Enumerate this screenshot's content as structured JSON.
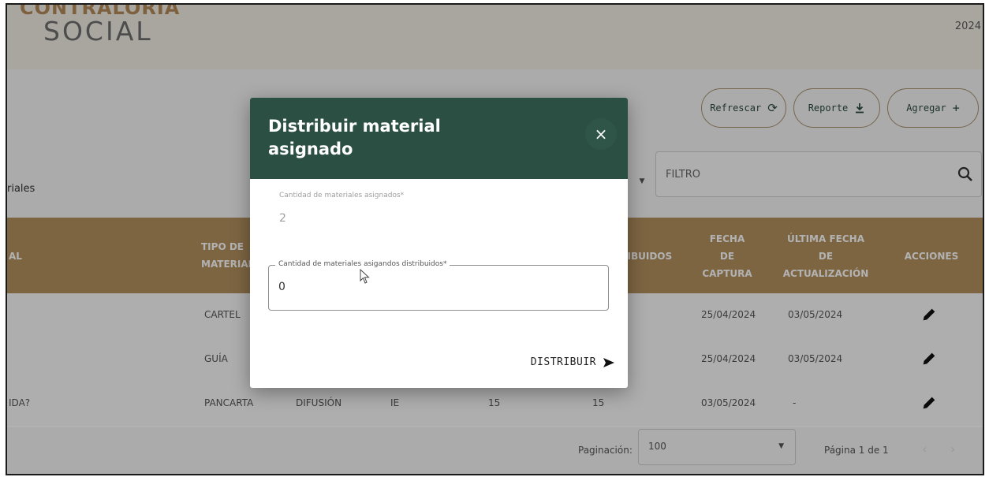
{
  "header": {
    "logo_line1": "CONTRALORIA",
    "logo_line2": "SOCIAL",
    "year": "2024"
  },
  "toolbar": {
    "refresh_label": "Refrescar",
    "report_label": "Reporte",
    "add_label": "Agregar"
  },
  "filter": {
    "left_text": "riales",
    "placeholder": "FILTRO"
  },
  "table": {
    "headers": {
      "col1": "AL",
      "tipo_line1": "TIPO DE",
      "tipo_line2": "MATERIAL",
      "distribuidos": "DISTRIBUIDOS",
      "fecha_line1": "FECHA",
      "fecha_line2": "DE",
      "fecha_line3": "CAPTURA",
      "ultima_line1": "ÚLTIMA FECHA",
      "ultima_line2": "DE",
      "ultima_line3": "ACTUALIZACIÓN",
      "acciones": "ACCIONES"
    },
    "rows": [
      {
        "col1": "",
        "tipo": "CARTEL",
        "col3": "",
        "col4": "",
        "col5": "",
        "col6": "",
        "fecha_captura": "25/04/2024",
        "ultima": "03/05/2024"
      },
      {
        "col1": "",
        "tipo": "GUÍA",
        "col3": "",
        "col4": "",
        "col5": "",
        "col6": "",
        "fecha_captura": "25/04/2024",
        "ultima": "03/05/2024"
      },
      {
        "col1": "IDA?",
        "tipo": "PANCARTA",
        "col3": "DIFUSIÓN",
        "col4": "IE",
        "col5": "15",
        "col6": "15",
        "fecha_captura": "03/05/2024",
        "ultima": "-"
      }
    ]
  },
  "pagination": {
    "label": "Paginación:",
    "value": "100",
    "page_info": "Página 1 de 1",
    "prev": "‹",
    "next": "›"
  },
  "modal": {
    "title": "Distribuir material asignado",
    "close": "×",
    "assigned_label": "Cantidad de materiales asignados*",
    "assigned_value": "2",
    "distributed_label": "Cantidad de materiales asigandos distribuidos*",
    "distributed_value": "0",
    "submit_label": "DISTRIBUIR"
  },
  "colors": {
    "header_green": "#2c4f44",
    "table_header_gold": "#b4915f",
    "button_border": "#a89270"
  },
  "icons": {
    "refresh": "refresh-icon",
    "report": "download-icon",
    "add": "plus-icon",
    "search": "search-icon",
    "edit": "pencil-icon",
    "close": "close-icon",
    "send": "send-icon"
  }
}
